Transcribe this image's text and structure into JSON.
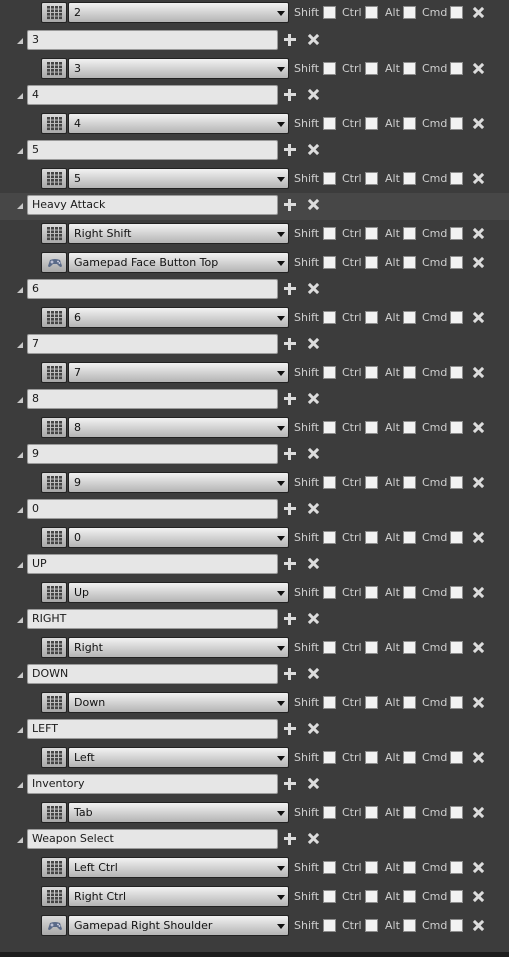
{
  "modifiers": {
    "shift": "Shift",
    "ctrl": "Ctrl",
    "alt": "Alt",
    "cmd": "Cmd"
  },
  "rows": [
    {
      "type": "key",
      "key": "2",
      "device": "keyboard"
    },
    {
      "type": "group",
      "name": "3"
    },
    {
      "type": "key",
      "key": "3",
      "device": "keyboard"
    },
    {
      "type": "group",
      "name": "4"
    },
    {
      "type": "key",
      "key": "4",
      "device": "keyboard"
    },
    {
      "type": "group",
      "name": "5"
    },
    {
      "type": "key",
      "key": "5",
      "device": "keyboard"
    },
    {
      "type": "group",
      "name": "Heavy Attack",
      "highlighted": true
    },
    {
      "type": "key",
      "key": "Right Shift",
      "device": "keyboard"
    },
    {
      "type": "key",
      "key": "Gamepad Face Button Top",
      "device": "gamepad"
    },
    {
      "type": "group",
      "name": "6"
    },
    {
      "type": "key",
      "key": "6",
      "device": "keyboard"
    },
    {
      "type": "group",
      "name": "7"
    },
    {
      "type": "key",
      "key": "7",
      "device": "keyboard"
    },
    {
      "type": "group",
      "name": "8"
    },
    {
      "type": "key",
      "key": "8",
      "device": "keyboard"
    },
    {
      "type": "group",
      "name": "9"
    },
    {
      "type": "key",
      "key": "9",
      "device": "keyboard"
    },
    {
      "type": "group",
      "name": "0"
    },
    {
      "type": "key",
      "key": "0",
      "device": "keyboard"
    },
    {
      "type": "group",
      "name": "UP"
    },
    {
      "type": "key",
      "key": "Up",
      "device": "keyboard"
    },
    {
      "type": "group",
      "name": "RIGHT"
    },
    {
      "type": "key",
      "key": "Right",
      "device": "keyboard"
    },
    {
      "type": "group",
      "name": "DOWN"
    },
    {
      "type": "key",
      "key": "Down",
      "device": "keyboard"
    },
    {
      "type": "group",
      "name": "LEFT"
    },
    {
      "type": "key",
      "key": "Left",
      "device": "keyboard"
    },
    {
      "type": "group",
      "name": "Inventory"
    },
    {
      "type": "key",
      "key": "Tab",
      "device": "keyboard"
    },
    {
      "type": "group",
      "name": "Weapon Select"
    },
    {
      "type": "key",
      "key": "Left Ctrl",
      "device": "keyboard"
    },
    {
      "type": "key",
      "key": "Right Ctrl",
      "device": "keyboard"
    },
    {
      "type": "key",
      "key": "Gamepad Right Shoulder",
      "device": "gamepad"
    }
  ]
}
